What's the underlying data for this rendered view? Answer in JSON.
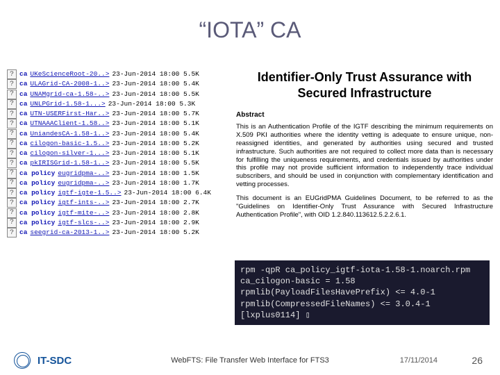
{
  "title": "“IOTA” CA",
  "files": [
    {
      "prefix": "ca",
      "name": "UKeScienceRoot-20..>",
      "date": "23-Jun-2014 18:00",
      "size": "5.5K"
    },
    {
      "prefix": "ca",
      "name": "ULAGrid-CA-2008-1..>",
      "date": "23-Jun-2014 18:00",
      "size": "5.4K"
    },
    {
      "prefix": "ca",
      "name": "UNAMgrid-ca-1.58-..>",
      "date": "23-Jun-2014 18:00",
      "size": "5.5K"
    },
    {
      "prefix": "ca",
      "name": "UNLPGrid-1.58-1...>",
      "date": "23-Jun-2014 18:00",
      "size": "5.3K"
    },
    {
      "prefix": "ca",
      "name": "UTN-USERFirst-Har..>",
      "date": "23-Jun-2014 18:00",
      "size": "5.7K"
    },
    {
      "prefix": "ca",
      "name": "UTNAAAClient-1.58..>",
      "date": "23-Jun-2014 18:00",
      "size": "5.1K"
    },
    {
      "prefix": "ca",
      "name": "UniandesCA-1.58-1..>",
      "date": "23-Jun-2014 18:00",
      "size": "5.4K"
    },
    {
      "prefix": "ca",
      "name": "cilogon-basic-1.5..>",
      "date": "23-Jun-2014 18:00",
      "size": "5.2K"
    },
    {
      "prefix": "ca",
      "name": "cilogon-silver-1...>",
      "date": "23-Jun-2014 18:00",
      "size": "5.1K"
    },
    {
      "prefix": "ca",
      "name": "pkIRISGrid-1.58-1..>",
      "date": "23-Jun-2014 18:00",
      "size": "5.5K"
    },
    {
      "prefix": "ca policy",
      "name": "eugridpma-..>",
      "date": "23-Jun-2014 18:00",
      "size": "1.5K"
    },
    {
      "prefix": "ca policy",
      "name": "eugridpma-..>",
      "date": "23-Jun-2014 18:00",
      "size": "1.7K"
    },
    {
      "prefix": "ca policy",
      "name": "igtf-igte-1.5..>",
      "date": "23-Jun-2014 18:00",
      "size": "6.4K"
    },
    {
      "prefix": "ca policy",
      "name": "igtf-ints-..>",
      "date": "23-Jun-2014 18:00",
      "size": "2.7K"
    },
    {
      "prefix": "ca policy",
      "name": "igtf-mite-..>",
      "date": "23-Jun-2014 18:00",
      "size": "2.8K"
    },
    {
      "prefix": "ca policy",
      "name": "igtf-slcs-..>",
      "date": "23-Jun-2014 18:00",
      "size": "2.9K"
    },
    {
      "prefix": "ca",
      "name": "seegrid-ca-2013-1..>",
      "date": "23-Jun-2014 18:00",
      "size": "5.2K"
    }
  ],
  "doc": {
    "title": "Identifier-Only Trust Assurance with Secured Infrastructure",
    "abstract_label": "Abstract",
    "para1": "This is an Authentication Profile of the IGTF describing the minimum requirements on X.509 PKI authorities where the identity vetting is adequate to ensure unique, non-reassigned identities, and generated by authorities using secured and trusted infrastructure. Such authorities are not required to collect more data than is necessary for fulfilling the uniqueness requirements, and credentials issued by authorities under this profile may not provide sufficient information to independently trace individual subscribers, and should be used in conjunction with complementary identification and vetting processes.",
    "para2": "This document is an EUGridPMA Guidelines Document, to be referred to as the \"Guidelines on Identifier-Only Trust Assurance with Secured Infrastructure Authentication Profile\", with OID 1.2.840.113612.5.2.2.6.1."
  },
  "terminal": {
    "line1": "rpm -qpR ca_policy_igtf-iota-1.58-1.noarch.rpm",
    "line2": "ca_cilogon-basic = 1.58",
    "line3": "rpmlib(PayloadFilesHavePrefix) <= 4.0-1",
    "line4": "rpmlib(CompressedFileNames) <= 3.0.4-1",
    "line5": "[lxplus0114] ▯"
  },
  "footer": {
    "org": "IT-SDC",
    "center": "WebFTS: File Transfer Web Interface for FTS3",
    "date": "17/11/2014",
    "page": "26"
  }
}
